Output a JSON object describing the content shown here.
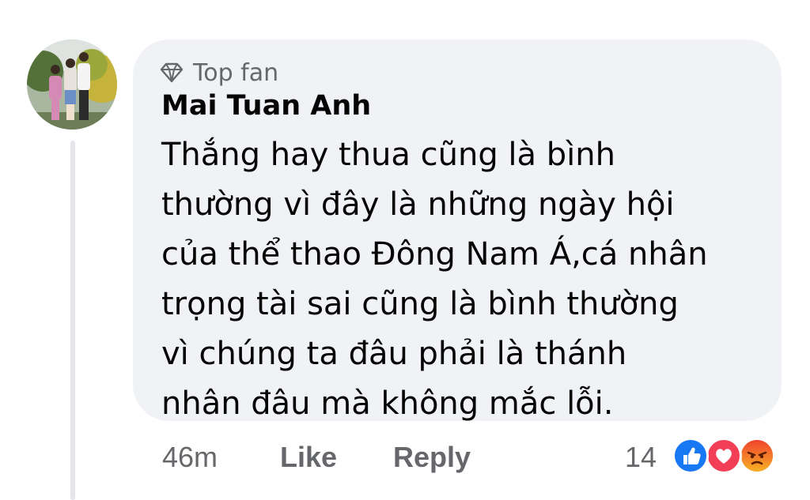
{
  "comment": {
    "badge": "Top fan",
    "author": "Mai Tuan Anh",
    "text": "Thắng hay thua cũng là bình\nthường vì đây là những ngày hội\ncủa thể thao Đông Nam Á,cá nhân\ntrọng tài sai cũng là bình thường\nvì chúng ta đâu phải là thánh\nnhân đâu mà không mắc lỗi."
  },
  "actions": {
    "time": "46m",
    "like_label": "Like",
    "reply_label": "Reply",
    "reaction_count": "14"
  },
  "reactions": [
    "like-icon",
    "love-icon",
    "angry-icon"
  ],
  "colors": {
    "bubble": "#f0f2f5",
    "like": "#1877f2",
    "love": "#f33e58",
    "angry": "#e9710f",
    "muted_text": "#65676b"
  }
}
